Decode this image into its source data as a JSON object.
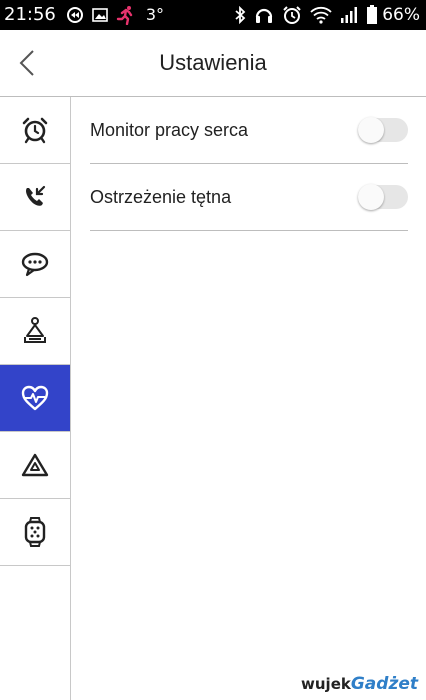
{
  "status_bar": {
    "time": "21:56",
    "temperature": "3°",
    "battery": "66%",
    "icons": [
      "sync-icon",
      "image-icon",
      "runner-icon",
      "bluetooth-icon",
      "headset-icon",
      "alarm-icon",
      "wifi-icon",
      "signal-icon",
      "battery-icon"
    ],
    "runner_color": "#e8336d"
  },
  "header": {
    "title": "Ustawienia",
    "back_icon": "chevron-left-icon"
  },
  "sidebar": {
    "items": [
      {
        "icon": "alarm-clock-icon",
        "active": false
      },
      {
        "icon": "incoming-call-icon",
        "active": false
      },
      {
        "icon": "message-bubble-icon",
        "active": false
      },
      {
        "icon": "meditation-icon",
        "active": false
      },
      {
        "icon": "heart-rate-icon",
        "active": true
      },
      {
        "icon": "triangle-icon",
        "active": false
      },
      {
        "icon": "smartwatch-icon",
        "active": false
      }
    ],
    "active_color": "#3344c9"
  },
  "settings": [
    {
      "label": "Monitor pracy serca",
      "enabled": false
    },
    {
      "label": "Ostrzeżenie tętna",
      "enabled": false
    }
  ],
  "watermark": {
    "prefix": "wujek",
    "brand": "Gadżet"
  }
}
